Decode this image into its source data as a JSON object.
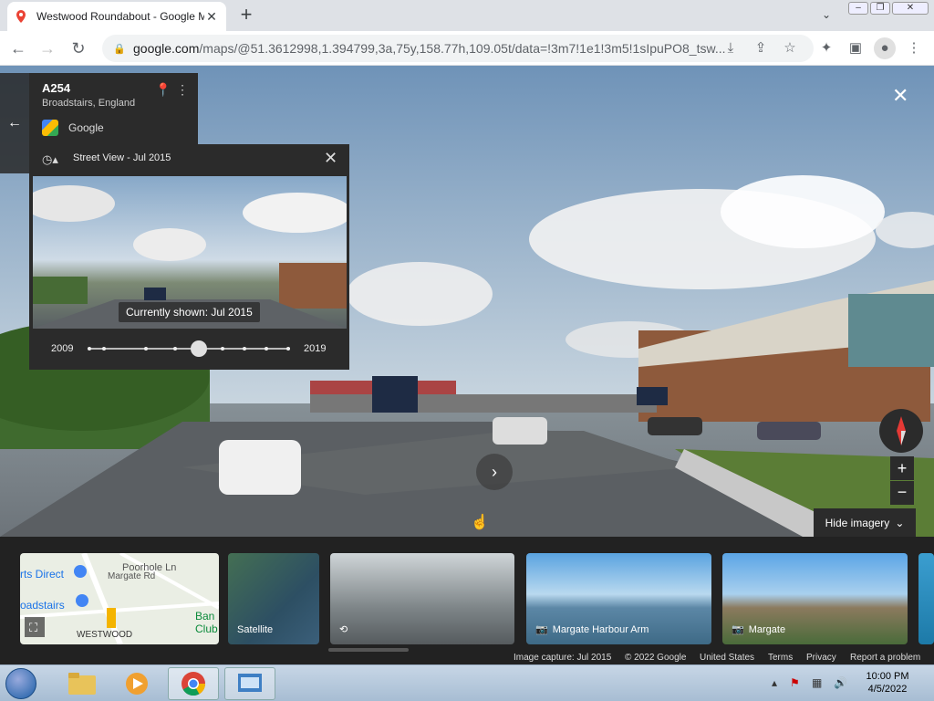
{
  "browser": {
    "tab_title": "Westwood Roundabout - Google Maps",
    "tab_close": "✕",
    "new_tab": "+",
    "url_domain": "google.com",
    "url_path": "/maps/@51.3612998,1.394799,3a,75y,158.77h,109.05t/data=!3m7!1e1!3m5!1sIpuPO8_tsw..."
  },
  "place": {
    "name": "A254",
    "location": "Broadstairs, England",
    "provider": "Google"
  },
  "time_panel": {
    "header": "Street View - Jul 2015",
    "currently_shown": "Currently shown: Jul 2015",
    "start_year": "2009",
    "end_year": "2019",
    "slider_position": 0.55
  },
  "controls": {
    "hide_imagery": "Hide imagery",
    "zoom_in": "+",
    "zoom_out": "−"
  },
  "filmstrip": [
    {
      "label": "",
      "type": "map",
      "map_labels": [
        "rts Direct",
        "Poorhole Ln",
        "oadstairs",
        "Margate Rd",
        "Ban",
        "Club",
        "WESTWOOD"
      ]
    },
    {
      "label": "Satellite",
      "type": "satellite"
    },
    {
      "label": "",
      "type": "street"
    },
    {
      "label": "Margate Harbour Arm",
      "type": "photo"
    },
    {
      "label": "Margate",
      "type": "photo"
    },
    {
      "label": "",
      "type": "photo"
    }
  ],
  "footer": {
    "capture": "Image capture: Jul 2015",
    "copyright": "© 2022 Google",
    "country": "United States",
    "terms": "Terms",
    "privacy": "Privacy",
    "report": "Report a problem"
  },
  "taskbar": {
    "time": "10:00 PM",
    "date": "4/5/2022"
  },
  "colors": {
    "panel": "#2b2b2b",
    "chrome_tabbar": "#dee1e6",
    "taskbar": "#b4c6d9"
  }
}
